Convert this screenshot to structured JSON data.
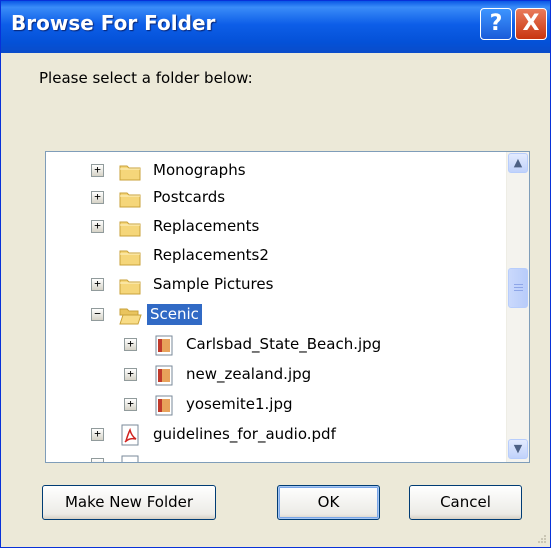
{
  "window": {
    "title": "Browse For Folder"
  },
  "titlebar_buttons": {
    "help": "?",
    "close": "X"
  },
  "prompt": "Please select a folder below:",
  "tree": {
    "items": [
      {
        "label": "Monographs",
        "icon": "folder-icon",
        "expander": "+"
      },
      {
        "label": "Postcards",
        "icon": "folder-icon",
        "expander": "+"
      },
      {
        "label": "Replacements",
        "icon": "folder-icon",
        "expander": "+"
      },
      {
        "label": "Replacements2",
        "icon": "folder-icon",
        "expander": ""
      },
      {
        "label": "Sample Pictures",
        "icon": "folder-icon",
        "expander": "+"
      },
      {
        "label": "Scenic",
        "icon": "folder-open-icon",
        "expander": "−",
        "selected": true
      },
      {
        "label": "Carlsbad_State_Beach.jpg",
        "icon": "image-file-icon",
        "expander": "+"
      },
      {
        "label": "new_zealand.jpg",
        "icon": "image-file-icon",
        "expander": "+"
      },
      {
        "label": "yosemite1.jpg",
        "icon": "image-file-icon",
        "expander": "+"
      },
      {
        "label": "guidelines_for_audio.pdf",
        "icon": "pdf-file-icon",
        "expander": "+"
      }
    ],
    "scrollbar": {
      "up": "▲",
      "down": "▼"
    }
  },
  "buttons": {
    "make_new_folder": "Make New Folder",
    "ok": "OK",
    "cancel": "Cancel"
  },
  "colors": {
    "titlebar": "#0a58e6",
    "selection": "#316ac5",
    "face": "#ece9d8"
  }
}
